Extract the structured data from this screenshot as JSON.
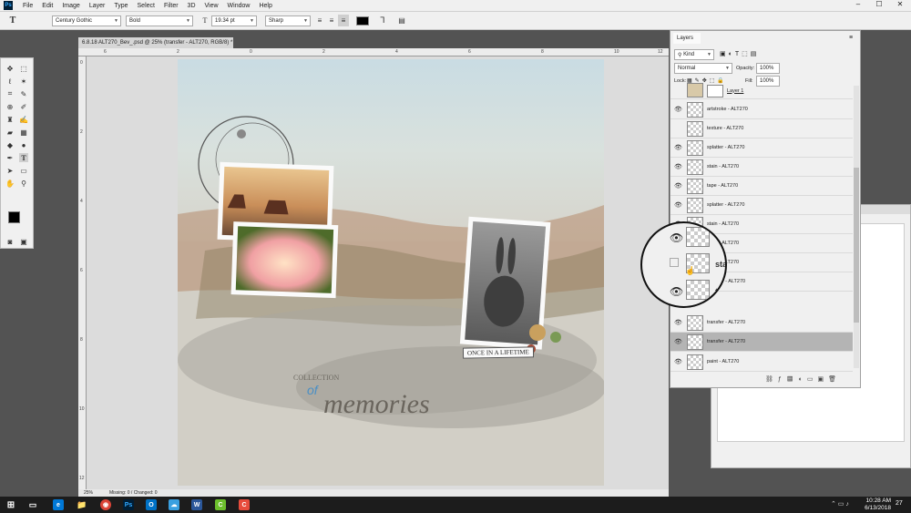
{
  "menubar": {
    "logo": "Ps",
    "items": [
      "File",
      "Edit",
      "Image",
      "Layer",
      "Type",
      "Select",
      "Filter",
      "3D",
      "View",
      "Window",
      "Help"
    ],
    "minimize": "–",
    "maximize": "☐",
    "close": "✕"
  },
  "options": {
    "font_family": "Century Gothic",
    "font_style": "Bold",
    "font_size": "19.34 pt",
    "antialias": "Sharp",
    "tool_letter": "T"
  },
  "document": {
    "tab_title": "6.8.18 ALT270_Bev_.psd @ 25% (transfer - ALT270, RGB/8) *",
    "zoom": "25%",
    "missing_changed": "Missing: 0 / Changed: 0",
    "ruler_top": [
      "6",
      "2",
      "0",
      "2",
      "4",
      "6",
      "8",
      "10",
      "12"
    ],
    "ruler_left": [
      "0",
      "2",
      "4",
      "6",
      "8",
      "10",
      "12"
    ]
  },
  "artwork": {
    "caption": "ONCE IN A LIFETIME",
    "collection_word": "COLLECTION",
    "of_word": "of",
    "memories_word": "memories"
  },
  "layers": {
    "tab": "Layers",
    "kind": "Kind",
    "blend": "Normal",
    "opacity_label": "Opacity:",
    "opacity": "100%",
    "lock_label": "Lock:",
    "fill_label": "Fill:",
    "fill": "100%",
    "rows": [
      {
        "name": "Layer 1",
        "visible": false
      },
      {
        "name": "artstroke - ALT270",
        "visible": true
      },
      {
        "name": "texture - ALT270",
        "visible": false
      },
      {
        "name": "splatter - ALT270",
        "visible": true
      },
      {
        "name": "stain - ALT270",
        "visible": true
      },
      {
        "name": "tape - ALT270",
        "visible": true
      },
      {
        "name": "splatter - ALT270",
        "visible": true
      },
      {
        "name": "stain - ALT270",
        "visible": true
      },
      {
        "name": "stain - ALT270",
        "visible": true
      },
      {
        "name": "stain - ALT270",
        "visible": false
      },
      {
        "name": "transfer - ALT270",
        "visible": true
      },
      {
        "name": "transfer - ALT270",
        "visible": true
      },
      {
        "name": "transfer - ALT270",
        "visible": true
      },
      {
        "name": "paint - ALT270",
        "visible": true
      }
    ],
    "magnifier_labels": [
      "stain",
      "tra"
    ]
  },
  "taskbar": {
    "time": "10:28 AM",
    "date": "6/13/2018",
    "notify_count": "27"
  },
  "colors": {
    "ps_blue": "#31a8ff",
    "taskbar": "#1c1c1c",
    "selected_row": "#b4b4b4"
  }
}
